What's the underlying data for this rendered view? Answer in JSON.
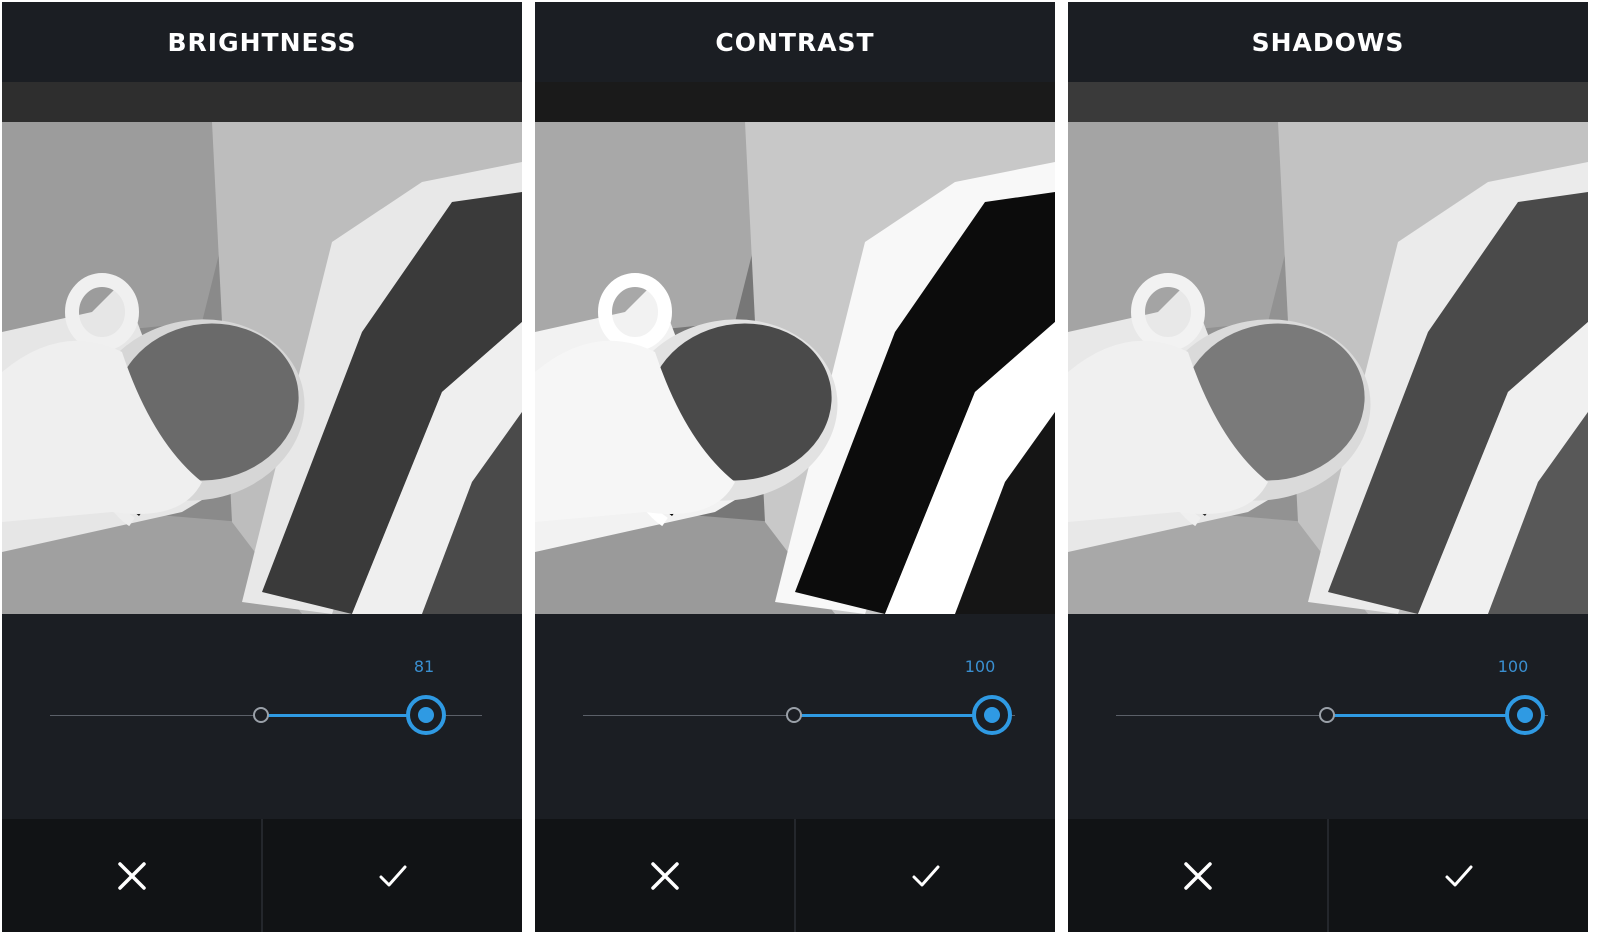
{
  "screens": [
    {
      "title": "BRIGHTNESS",
      "slider_value": "81",
      "slider_level": 0.81,
      "cancel_icon": "close-icon",
      "confirm_icon": "checkmark-icon"
    },
    {
      "title": "CONTRAST",
      "slider_value": "100",
      "slider_level": 1.0,
      "cancel_icon": "close-icon",
      "confirm_icon": "checkmark-icon"
    },
    {
      "title": "SHADOWS",
      "slider_value": "100",
      "slider_level": 1.0,
      "cancel_icon": "close-icon",
      "confirm_icon": "checkmark-icon"
    }
  ],
  "colors": {
    "accent": "#2f9ae3",
    "background": "#1b1e23",
    "action_bar": "#111315"
  }
}
